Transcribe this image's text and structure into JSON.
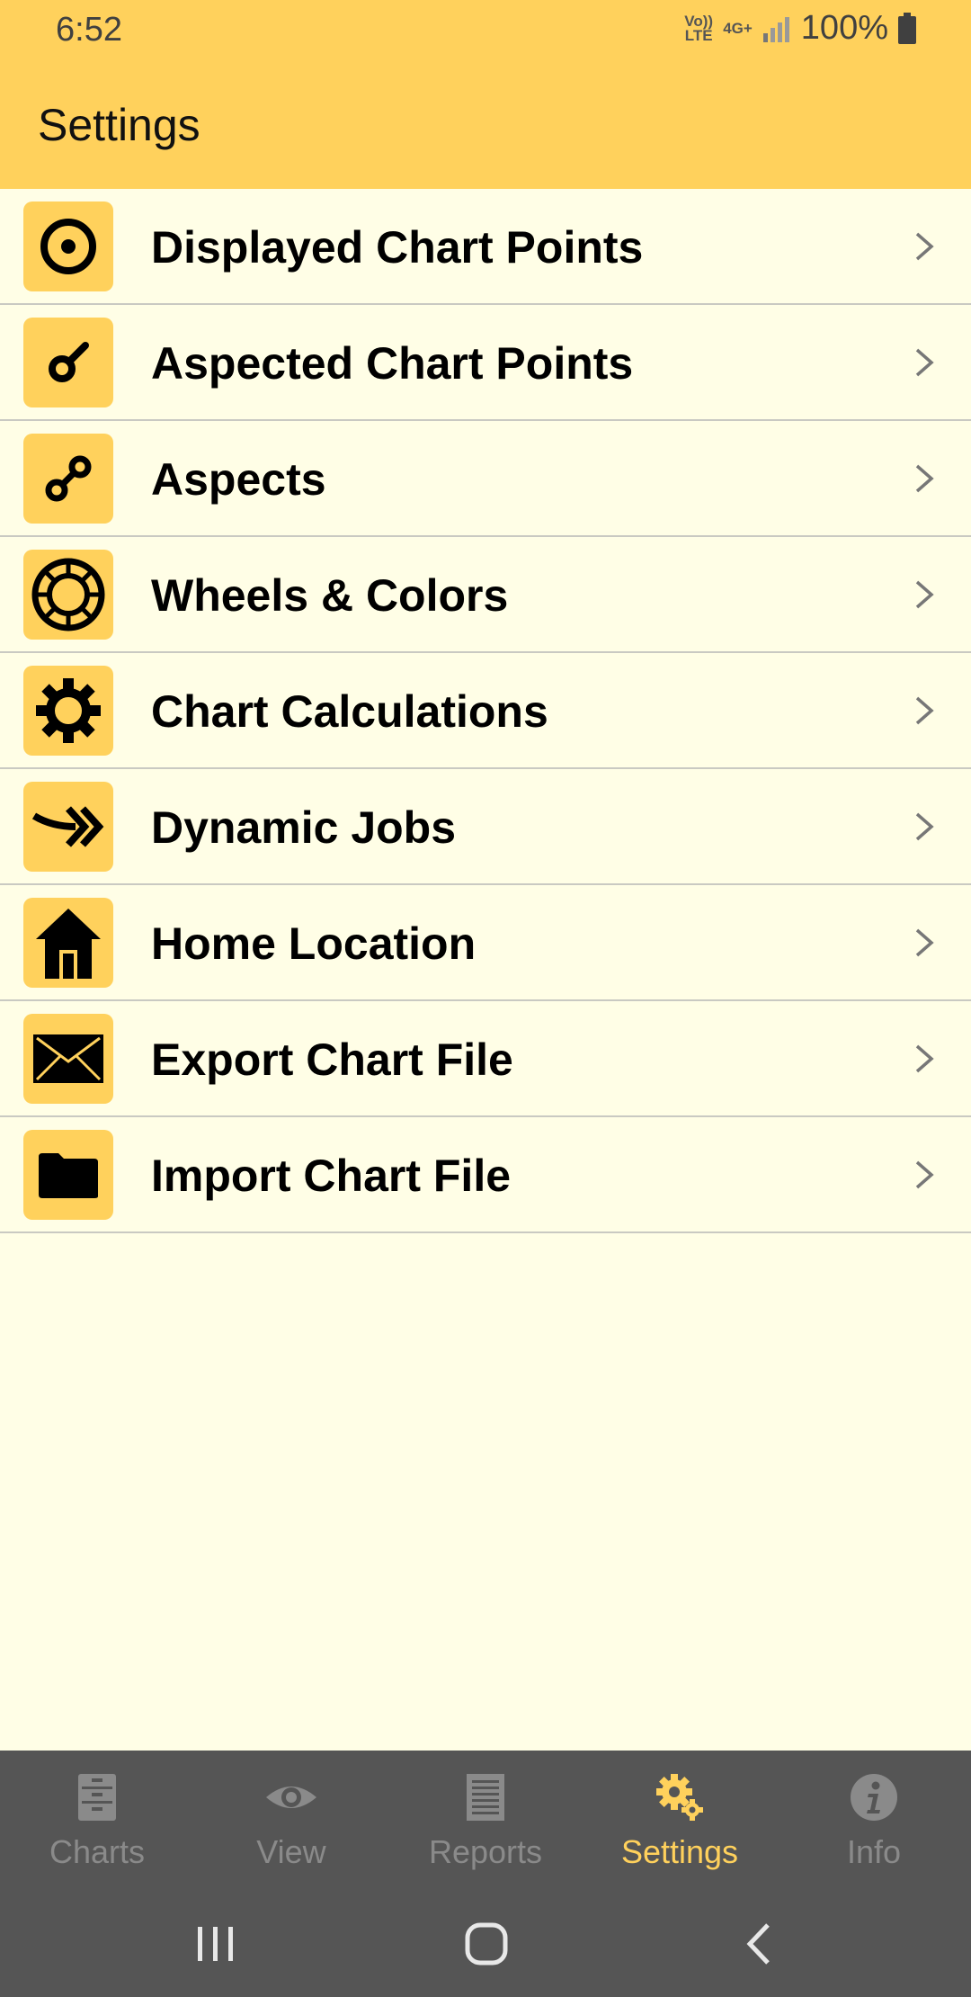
{
  "status": {
    "time": "6:52",
    "volte": "Vo)) LTE",
    "network": "4G+",
    "battery": "100%"
  },
  "appbar": {
    "title": "Settings"
  },
  "settings_items": [
    {
      "label": "Displayed Chart Points",
      "icon": "target-icon"
    },
    {
      "label": "Aspected Chart Points",
      "icon": "chart-point-icon"
    },
    {
      "label": "Aspects",
      "icon": "aspect-link-icon"
    },
    {
      "label": "Wheels & Colors",
      "icon": "wheel-icon"
    },
    {
      "label": "Chart Calculations",
      "icon": "gear-icon"
    },
    {
      "label": "Dynamic Jobs",
      "icon": "forward-arrow-icon"
    },
    {
      "label": "Home Location",
      "icon": "house-icon"
    },
    {
      "label": "Export Chart File",
      "icon": "envelope-icon"
    },
    {
      "label": "Import Chart File",
      "icon": "folder-icon"
    }
  ],
  "bottom_nav": {
    "tabs": [
      {
        "label": "Charts",
        "icon": "file-cabinet-icon"
      },
      {
        "label": "View",
        "icon": "eye-icon"
      },
      {
        "label": "Reports",
        "icon": "document-icon"
      },
      {
        "label": "Settings",
        "icon": "gears-icon",
        "active": true
      },
      {
        "label": "Info",
        "icon": "info-icon"
      }
    ]
  },
  "colors": {
    "accent": "#ffd15c",
    "background": "#fffee6",
    "nav": "#555555"
  }
}
